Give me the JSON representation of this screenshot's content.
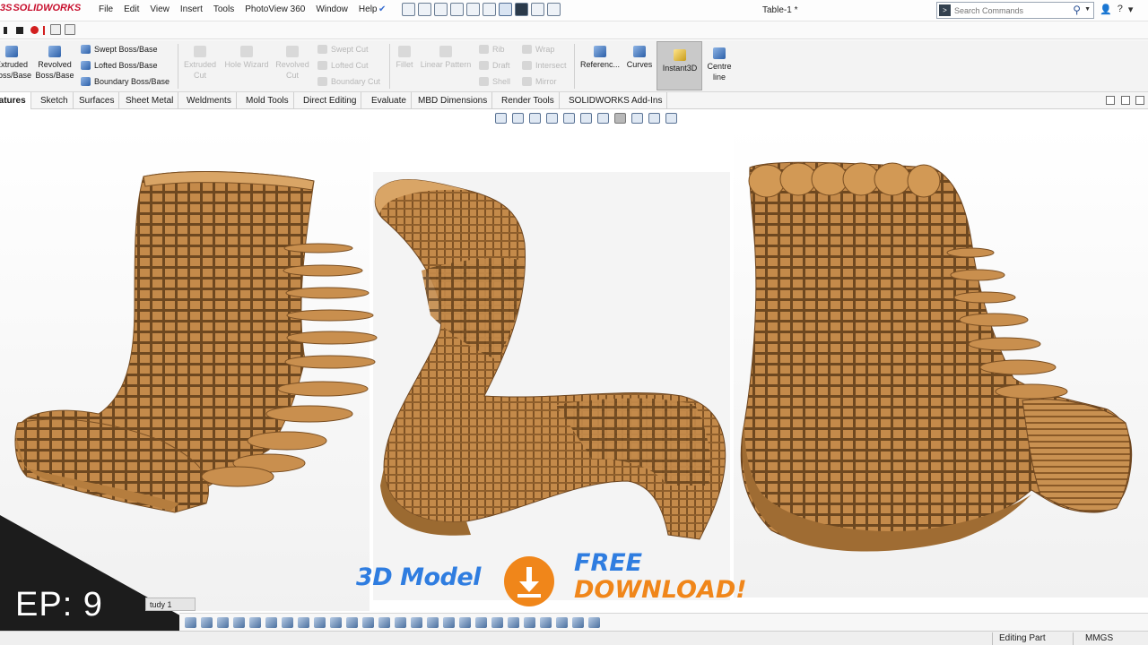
{
  "app": {
    "logo_ds": "3S",
    "logo_name": "SOLIDWORKS",
    "document_title": "Table-1 *"
  },
  "menu": {
    "items": [
      "File",
      "Edit",
      "View",
      "Insert",
      "Tools",
      "PhotoView 360",
      "Window",
      "Help"
    ]
  },
  "search": {
    "placeholder": "Search Commands"
  },
  "ribbon": {
    "extruded_boss": "Extruded\nBoss/Base",
    "revolved_boss": "Revolved\nBoss/Base",
    "swept_boss": "Swept Boss/Base",
    "lofted_boss": "Lofted Boss/Base",
    "boundary_boss": "Boundary Boss/Base",
    "extruded_cut": "Extruded\nCut",
    "hole_wizard": "Hole Wizard",
    "revolved_cut": "Revolved\nCut",
    "swept_cut": "Swept Cut",
    "lofted_cut": "Lofted Cut",
    "boundary_cut": "Boundary Cut",
    "fillet": "Fillet",
    "linear_pattern": "Linear Pattern",
    "rib": "Rib",
    "draft": "Draft",
    "shell": "Shell",
    "wrap": "Wrap",
    "intersect": "Intersect",
    "mirror": "Mirror",
    "reference": "Referenc...",
    "curves": "Curves",
    "instant3d": "Instant3D",
    "centre_line": "Centre\nline"
  },
  "tabs": [
    "Features",
    "Sketch",
    "Surfaces",
    "Sheet Metal",
    "Weldments",
    "Mold Tools",
    "Direct Editing",
    "Evaluate",
    "MBD Dimensions",
    "Render Tools",
    "SOLIDWORKS Add-Ins"
  ],
  "active_tab": "Features",
  "bottom": {
    "study_tab": "tudy 1",
    "episode": "EP: 9"
  },
  "status": {
    "mode": "Editing Part",
    "units": "MMGS"
  },
  "promo": {
    "model_text": "3D Model",
    "free_text": "FREE",
    "download_text": "DOWNLOAD!",
    "accent_blue": "#2f7de0",
    "accent_orange": "#f0861a"
  },
  "colors": {
    "cardboard": "#c48a4a",
    "cardboard_light": "#d9a566",
    "cardboard_dark": "#8a5a28",
    "logo_red": "#c8102e"
  }
}
